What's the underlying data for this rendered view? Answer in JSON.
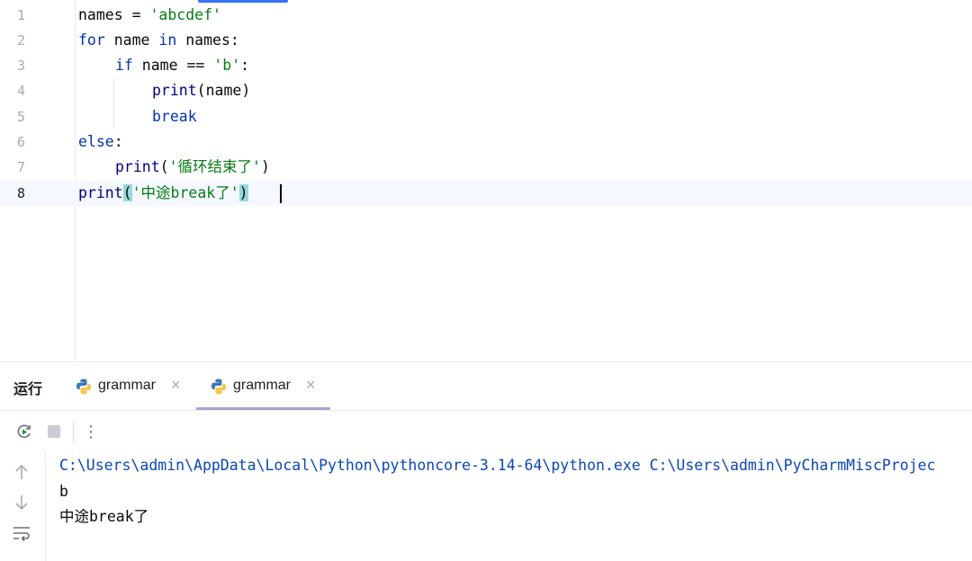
{
  "editor": {
    "lines": [
      {
        "n": "1"
      },
      {
        "n": "2"
      },
      {
        "n": "3"
      },
      {
        "n": "4"
      },
      {
        "n": "5"
      },
      {
        "n": "6"
      },
      {
        "n": "7"
      },
      {
        "n": "8"
      }
    ],
    "code": {
      "l1_a": "names = ",
      "l1_b": "'abcdef'",
      "l2_a": "for",
      "l2_b": " name ",
      "l2_c": "in",
      "l2_d": " names:",
      "l3_a": "if",
      "l3_b": " name == ",
      "l3_c": "'b'",
      "l3_d": ":",
      "l4_a": "print",
      "l4_b": "(name)",
      "l5_a": "break",
      "l6_a": "else",
      "l6_b": ":",
      "l7_a": "print",
      "l7_b": "(",
      "l7_c": "'",
      "l7_d": "循环结束了",
      "l7_e": "'",
      "l7_f": ")",
      "l8_a": "print",
      "l8_b": "(",
      "l8_c": "'",
      "l8_d": "中途",
      "l8_e": "break",
      "l8_f": "了",
      "l8_g": "'",
      "l8_h": ")"
    }
  },
  "run_panel": {
    "title": "运行",
    "tabs": [
      {
        "label": "grammar",
        "close": "×"
      },
      {
        "label": "grammar",
        "close": "×"
      }
    ],
    "toolbar": {
      "more": "⋮"
    },
    "console": {
      "command": "C:\\Users\\admin\\AppData\\Local\\Python\\pythoncore-3.14-64\\python.exe C:\\Users\\admin\\PyCharmMiscProjec",
      "out1": "b",
      "out2_cjk": "中途",
      "out2_en": "break",
      "out2_end": "了"
    },
    "icons": [
      "rerun-icon",
      "stop-icon",
      "more-icon",
      "scroll-up-icon",
      "scroll-down-icon",
      "soft-wrap-icon"
    ]
  },
  "colors": {
    "keyword": "#0033b3",
    "string": "#067d17",
    "function": "#000080",
    "path": "#0a47b8",
    "accent": "#3574f0"
  }
}
